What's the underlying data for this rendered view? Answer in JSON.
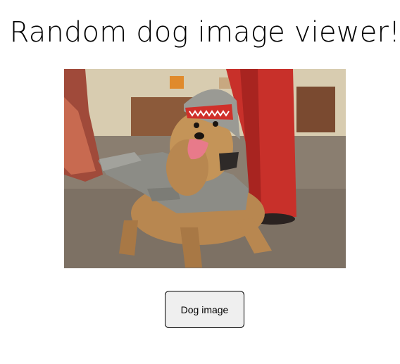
{
  "page": {
    "title": "Random dog image viewer!"
  },
  "image": {
    "subject": "dog-photo"
  },
  "controls": {
    "fetch_button_label": "Dog image"
  },
  "colors": {
    "page_background": "#ffffff",
    "button_background": "#efefef",
    "button_border": "#000000"
  }
}
